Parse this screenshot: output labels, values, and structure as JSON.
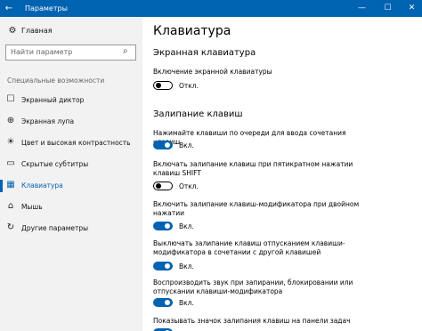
{
  "window": {
    "title": "Параметры",
    "back_icon": "←",
    "min_icon": "—",
    "max_icon": "☐",
    "close_icon": "✕"
  },
  "sidebar": {
    "home": {
      "icon": "⚙",
      "label": "Главная"
    },
    "search": {
      "placeholder": "Найти параметр",
      "icon": "⌕"
    },
    "section_label": "Специальные возможности",
    "items": [
      {
        "icon": "☐",
        "label": "Экранный диктор"
      },
      {
        "icon": "⊕",
        "label": "Экранная лупа"
      },
      {
        "icon": "☀",
        "label": "Цвет и высокая контрастность"
      },
      {
        "icon": "▭",
        "label": "Скрытые субтитры"
      },
      {
        "icon": "▦",
        "label": "Клавиатура"
      },
      {
        "icon": "⌂",
        "label": "Мышь"
      },
      {
        "icon": "↻",
        "label": "Другие параметры"
      }
    ]
  },
  "main": {
    "title": "Клавиатура",
    "onscreen": {
      "heading": "Экранная клавиатура",
      "setting_label": "Включение экранной клавиатуры",
      "state": "Откл."
    },
    "sticky": {
      "heading": "Залипание клавиш",
      "settings": [
        {
          "label": "Нажимайте клавиши по очереди для ввода сочетания клавиш",
          "state": "Вкл.",
          "on": true
        },
        {
          "label": "Включать залипание клавиш при пятикратном нажатии клавиш SHIFT",
          "state": "Откл.",
          "on": false
        },
        {
          "label": "Включить залипание клавиш-модификатора при двойном нажатии",
          "state": "Вкл.",
          "on": true
        },
        {
          "label": "Выключать залипание клавиш отпусканием клавиши-модификатора в сочетании с другой клавишей",
          "state": "Вкл.",
          "on": true
        },
        {
          "label": "Воспроизводить звук при запирании, блокировании или отпускании клавиши-модификатора",
          "state": "Вкл.",
          "on": true
        },
        {
          "label": "Показывать значок залипания клавиш на панели задач",
          "state": "",
          "on": true
        }
      ]
    }
  },
  "colors": {
    "accent": "#0063b1",
    "sidebar_bg": "#f2f2f2"
  }
}
